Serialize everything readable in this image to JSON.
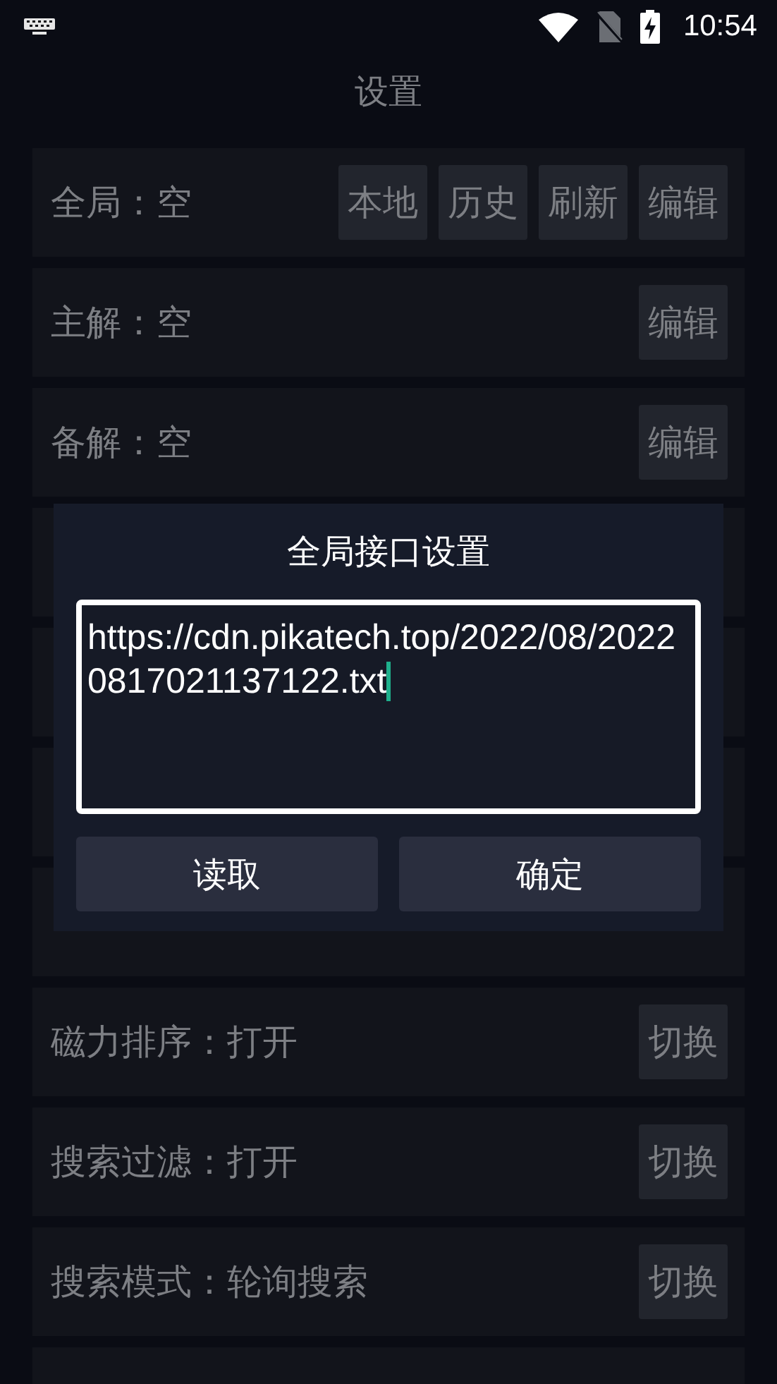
{
  "status_bar": {
    "time": "10:54"
  },
  "title": "设置",
  "rows": [
    {
      "kind": "setting",
      "label": "全局：空",
      "buttons": [
        "本地",
        "历史",
        "刷新",
        "编辑"
      ]
    },
    {
      "kind": "setting",
      "label": "主解：空",
      "buttons": [
        "编辑"
      ]
    },
    {
      "kind": "setting",
      "label": "备解：空",
      "buttons": [
        "编辑"
      ]
    },
    {
      "kind": "covered"
    },
    {
      "kind": "covered"
    },
    {
      "kind": "covered"
    },
    {
      "kind": "covered"
    },
    {
      "kind": "setting",
      "label": "磁力排序：打开",
      "buttons": [
        "切换"
      ]
    },
    {
      "kind": "setting",
      "label": "搜索过滤：打开",
      "buttons": [
        "切换"
      ]
    },
    {
      "kind": "setting",
      "label": "搜索模式：轮询搜索",
      "buttons": [
        "切换"
      ]
    },
    {
      "kind": "covered"
    }
  ],
  "dialog": {
    "title": "全局接口设置",
    "value": "https://cdn.pikatech.top/2022/08/20220817021137122.txt",
    "buttons": [
      "读取",
      "确定"
    ]
  }
}
